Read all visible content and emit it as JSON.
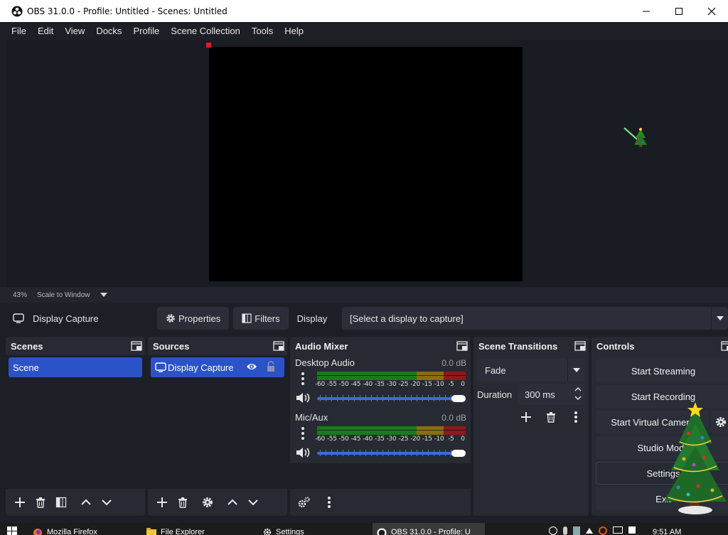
{
  "window": {
    "title": "OBS 31.0.0 - Profile: Untitled - Scenes: Untitled",
    "controls": [
      "minimize-icon",
      "maximize-icon",
      "close-icon"
    ]
  },
  "menu": [
    "File",
    "Edit",
    "View",
    "Docks",
    "Profile",
    "Scene Collection",
    "Tools",
    "Help"
  ],
  "zoom": {
    "percent": "43%",
    "mode": "Scale to Window"
  },
  "context": {
    "source_name": "Display Capture",
    "properties_label": "Properties",
    "filters_label": "Filters",
    "display_label": "Display",
    "display_value": "[Select a display to capture]"
  },
  "scenes": {
    "title": "Scenes",
    "items": [
      "Scene"
    ]
  },
  "sources": {
    "title": "Sources",
    "items": [
      {
        "name": "Display Capture",
        "visible": true,
        "locked": false
      }
    ]
  },
  "audio_mixer": {
    "title": "Audio Mixer",
    "channels": [
      {
        "name": "Desktop Audio",
        "db": "0.0 dB",
        "volume": 1.0
      },
      {
        "name": "Mic/Aux",
        "db": "0.0 dB",
        "volume": 1.0
      }
    ],
    "ticks": [
      "-60",
      "-55",
      "-50",
      "-45",
      "-40",
      "-35",
      "-30",
      "-25",
      "-20",
      "-15",
      "-10",
      "-5",
      "0"
    ]
  },
  "transitions": {
    "title": "Scene Transitions",
    "selected": "Fade",
    "duration_label": "Duration",
    "duration_value": "300 ms"
  },
  "controls": {
    "title": "Controls",
    "buttons": [
      "Start Streaming",
      "Start Recording",
      "Start Virtual Camera",
      "Studio Mode",
      "Settings",
      "Exit"
    ]
  },
  "taskbar": {
    "items": [
      "Mozilla Firefox",
      "File Explorer",
      "Settings",
      "OBS 31.0.0 - Profile: U"
    ],
    "clock": "9:51 AM"
  },
  "colors": {
    "accent": "#2c52c7",
    "background": "#1d1f26",
    "dock": "#272a33",
    "button": "#2b2e38",
    "meter_green": "#1b7a1b",
    "meter_yellow": "#8a6d12",
    "meter_red": "#8b1a1a"
  }
}
